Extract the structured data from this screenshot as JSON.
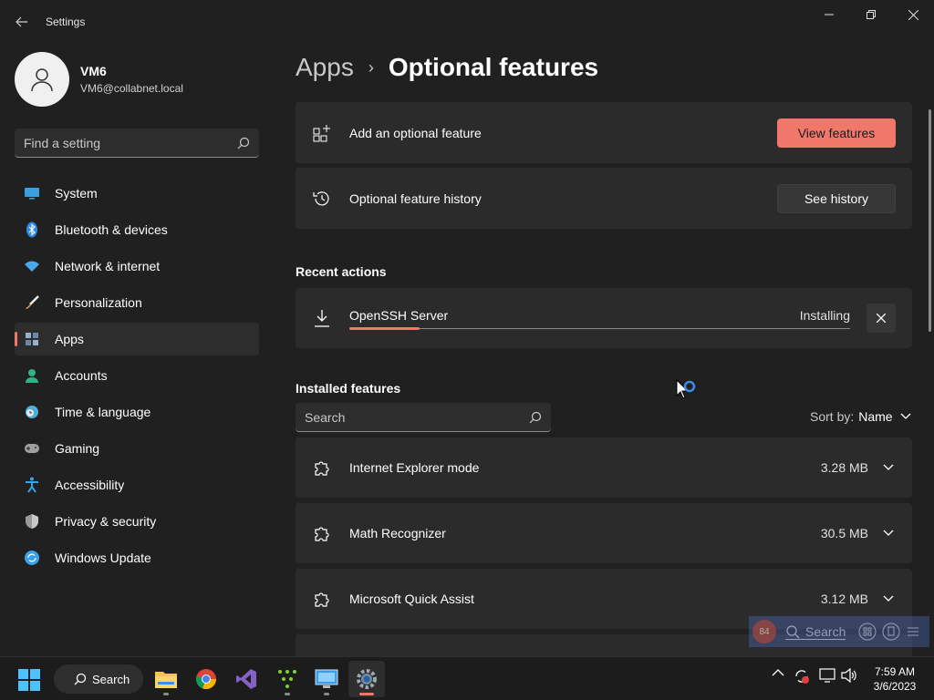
{
  "window": {
    "title": "Settings",
    "back_icon": "back-arrow-icon",
    "controls": [
      "minimize-icon",
      "restore-icon",
      "close-icon"
    ]
  },
  "profile": {
    "name": "VM6",
    "email": "VM6@collabnet.local"
  },
  "sidebar": {
    "search_placeholder": "Find a setting",
    "items": [
      {
        "label": "System",
        "icon": "monitor-icon",
        "color": "#3aa0e0"
      },
      {
        "label": "Bluetooth & devices",
        "icon": "bluetooth-icon",
        "color": "#2b8ae6"
      },
      {
        "label": "Network & internet",
        "icon": "wifi-icon",
        "color": "#4aa8ec"
      },
      {
        "label": "Personalization",
        "icon": "brush-icon",
        "color": "#e0a060"
      },
      {
        "label": "Apps",
        "icon": "apps-icon",
        "color": "#9ab0c8",
        "active": true
      },
      {
        "label": "Accounts",
        "icon": "person-icon",
        "color": "#2fb38a"
      },
      {
        "label": "Time & language",
        "icon": "globe-clock-icon",
        "color": "#4ab0e0"
      },
      {
        "label": "Gaming",
        "icon": "gamepad-icon",
        "color": "#a0a0a0"
      },
      {
        "label": "Accessibility",
        "icon": "accessibility-icon",
        "color": "#3aa0e8"
      },
      {
        "label": "Privacy & security",
        "icon": "shield-icon",
        "color": "#9a9a9a"
      },
      {
        "label": "Windows Update",
        "icon": "update-icon",
        "color": "#3aa0e8"
      }
    ]
  },
  "breadcrumb": {
    "parent": "Apps",
    "separator": "›",
    "current": "Optional features"
  },
  "add_feature": {
    "label": "Add an optional feature",
    "button": "View features"
  },
  "history": {
    "label": "Optional feature history",
    "button": "See history"
  },
  "recent": {
    "title": "Recent actions",
    "item": {
      "name": "OpenSSH Server",
      "status": "Installing",
      "progress": 0.14
    }
  },
  "installed": {
    "title": "Installed features",
    "search_placeholder": "Search",
    "sort_label": "Sort by:",
    "sort_value": "Name",
    "features": [
      {
        "name": "Internet Explorer mode",
        "size": "3.28 MB"
      },
      {
        "name": "Math Recognizer",
        "size": "30.5 MB"
      },
      {
        "name": "Microsoft Quick Assist",
        "size": "3.12 MB"
      }
    ]
  },
  "overlay": {
    "badge": "84",
    "search": "Search"
  },
  "taskbar": {
    "search_label": "Search",
    "apps": [
      "file-explorer-icon",
      "chrome-icon",
      "visual-studio-icon",
      "app-grid-icon",
      "remote-desktop-icon",
      "settings-gear-icon"
    ],
    "time": "7:59 AM",
    "date": "3/6/2023"
  },
  "colors": {
    "accent": "#f0776a",
    "background": "#202020",
    "card": "#2b2b2b"
  }
}
